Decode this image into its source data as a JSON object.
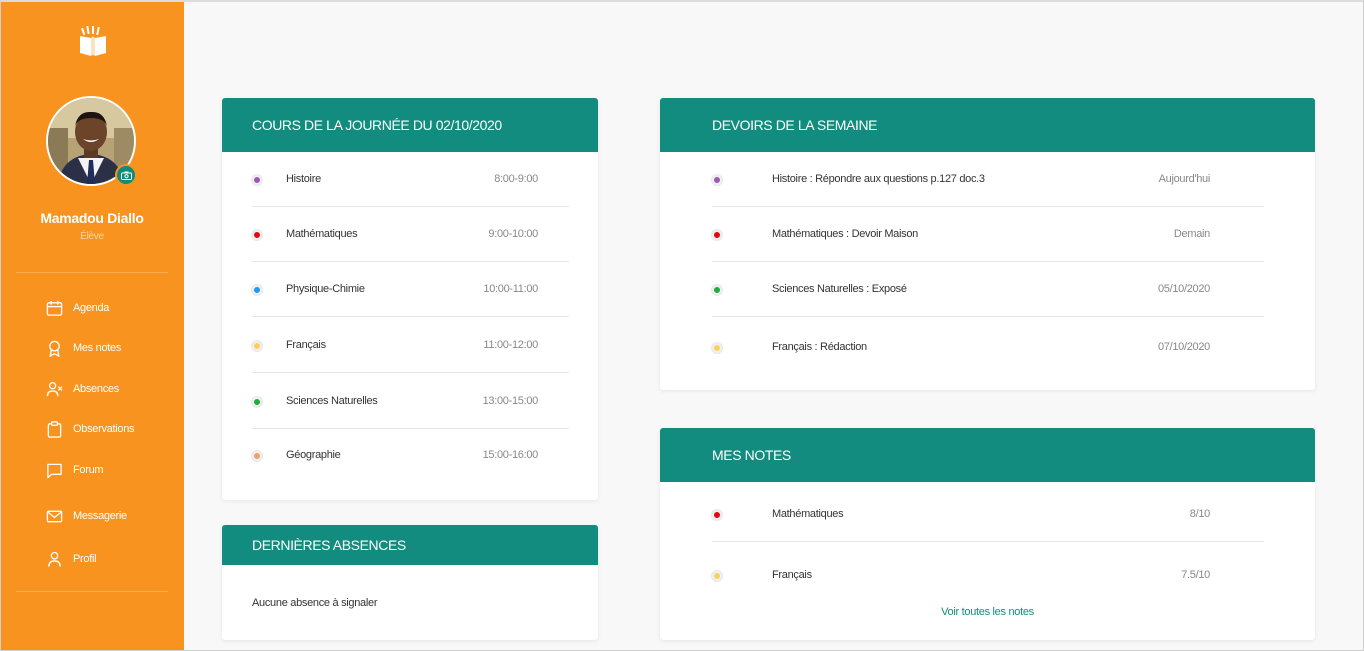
{
  "user": {
    "name": "Mamadou Diallo",
    "role": "Élève"
  },
  "nav": [
    {
      "label": "Agenda",
      "icon": "calendar-icon"
    },
    {
      "label": "Mes notes",
      "icon": "award-icon"
    },
    {
      "label": "Absences",
      "icon": "user-x-icon"
    },
    {
      "label": "Observations",
      "icon": "clipboard-icon"
    },
    {
      "label": "Forum",
      "icon": "chat-icon"
    },
    {
      "label": "Messagerie",
      "icon": "mail-icon"
    },
    {
      "label": "Profil",
      "icon": "user-icon"
    }
  ],
  "courses": {
    "title": "COURS DE LA JOURNÉE DU 02/10/2020",
    "items": [
      {
        "subject": "Histoire",
        "time": "8:00-9:00",
        "color": "#9b59b6"
      },
      {
        "subject": "Mathématiques",
        "time": "9:00-10:00",
        "color": "#e30613"
      },
      {
        "subject": "Physique-Chimie",
        "time": "10:00-11:00",
        "color": "#1e9cf0"
      },
      {
        "subject": "Français",
        "time": "11:00-12:00",
        "color": "#fcd15b"
      },
      {
        "subject": "Sciences Naturelles",
        "time": "13:00-15:00",
        "color": "#1fae3a"
      },
      {
        "subject": "Géographie",
        "time": "15:00-16:00",
        "color": "#f0a068"
      }
    ]
  },
  "absences": {
    "title": "DERNIÈRES ABSENCES",
    "message": "Aucune absence à signaler"
  },
  "homework": {
    "title": "DEVOIRS DE LA SEMAINE",
    "items": [
      {
        "task": "Histoire : Répondre aux questions p.127 doc.3",
        "due": "Aujourd'hui",
        "color": "#9b59b6"
      },
      {
        "task": "Mathématiques : Devoir Maison",
        "due": "Demain",
        "color": "#e30613"
      },
      {
        "task": "Sciences Naturelles : Exposé",
        "due": "05/10/2020",
        "color": "#1fae3a"
      },
      {
        "task": "Français : Rédaction",
        "due": "07/10/2020",
        "color": "#fcd15b"
      }
    ]
  },
  "grades": {
    "title": "MES NOTES",
    "items": [
      {
        "subject": "Mathématiques",
        "grade": "8/10",
        "color": "#e30613"
      },
      {
        "subject": "Français",
        "grade": "7.5/10",
        "color": "#fcd15b"
      }
    ],
    "link": "Voir toutes les notes"
  }
}
